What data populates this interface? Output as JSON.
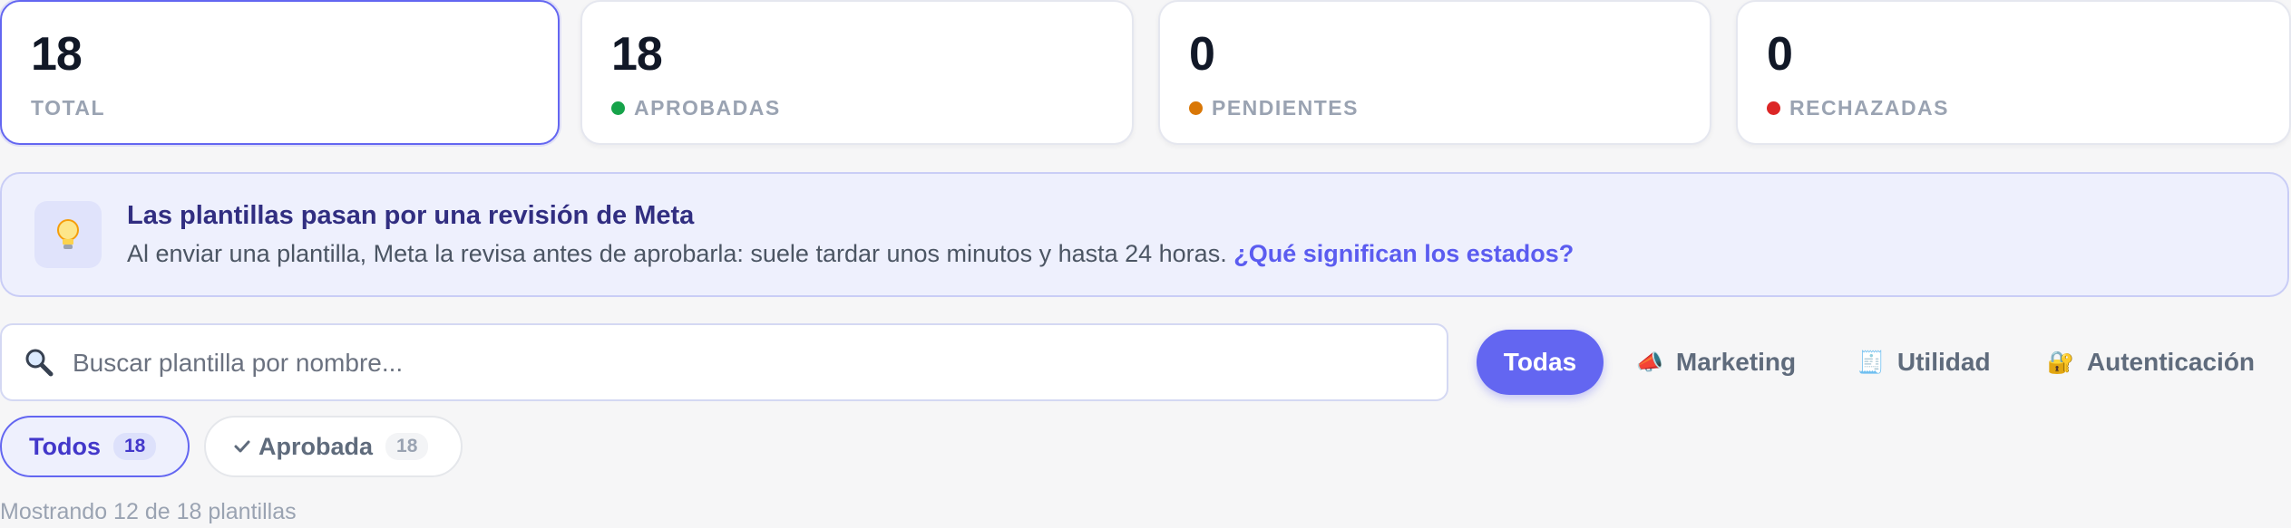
{
  "stats": [
    {
      "value": "18",
      "label": "TOTAL"
    },
    {
      "value": "18",
      "label": "APROBADAS",
      "dot_color": "#16a34a"
    },
    {
      "value": "0",
      "label": "PENDIENTES",
      "dot_color": "#d97706"
    },
    {
      "value": "0",
      "label": "RECHAZADAS",
      "dot_color": "#dc2626"
    }
  ],
  "banner": {
    "icon": "lightbulb-icon",
    "title": "Las plantillas pasan por una revisión de Meta",
    "text": "Al enviar una plantilla, Meta la revisa antes de aprobarla: suele tardar unos minutos y hasta 24 horas.",
    "link": "¿Qué significan los estados?"
  },
  "search": {
    "icon": "search-icon",
    "placeholder": "Buscar plantilla por nombre...",
    "value": ""
  },
  "categories": [
    {
      "label": "Todas",
      "emoji": "",
      "active": true
    },
    {
      "label": "Marketing",
      "emoji": "📣",
      "active": false
    },
    {
      "label": "Utilidad",
      "emoji": "🧾",
      "active": false
    },
    {
      "label": "Autenticación",
      "emoji": "🔐",
      "active": false
    }
  ],
  "status_filters": [
    {
      "label": "Todos",
      "count": "18",
      "active": true
    },
    {
      "label": "Aprobada",
      "icon": "check-icon",
      "count": "18",
      "active": false
    }
  ],
  "results_text": "Mostrando 12 de 18 plantillas",
  "colors": {
    "accent": "#6366f1",
    "approved": "#16a34a",
    "pending": "#d97706",
    "rejected": "#dc2626"
  }
}
